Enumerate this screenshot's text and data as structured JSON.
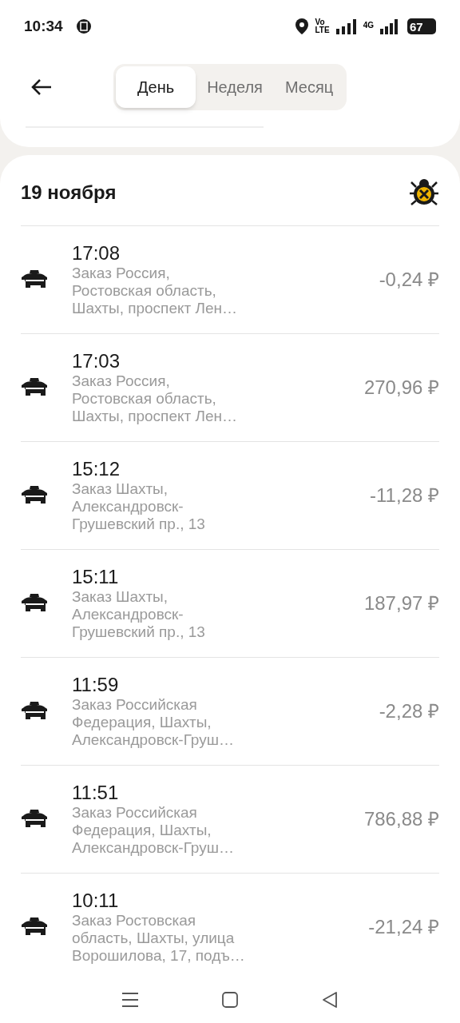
{
  "status_bar": {
    "time": "10:34",
    "volte_top": "Vo",
    "volte_bottom": "LTE",
    "network": "4G",
    "battery": "67"
  },
  "tabs": [
    {
      "label": "День",
      "selected": true
    },
    {
      "label": "Неделя",
      "selected": false
    },
    {
      "label": "Месяц",
      "selected": false
    }
  ],
  "date_heading": "19 ноября",
  "orders": [
    {
      "time": "17:08",
      "description": [
        "Заказ Россия,",
        "Ростовская область,",
        "Шахты, проспект Лен…"
      ],
      "amount": "-0,24 ₽"
    },
    {
      "time": "17:03",
      "description": [
        "Заказ Россия,",
        "Ростовская область,",
        "Шахты, проспект Лен…"
      ],
      "amount": "270,96 ₽"
    },
    {
      "time": "15:12",
      "description": [
        "Заказ Шахты,",
        "Александровск-",
        "Грушевский пр., 13"
      ],
      "amount": "-11,28 ₽"
    },
    {
      "time": "15:11",
      "description": [
        "Заказ Шахты,",
        "Александровск-",
        "Грушевский пр., 13"
      ],
      "amount": "187,97 ₽"
    },
    {
      "time": "11:59",
      "description": [
        "Заказ Российская",
        "Федерация, Шахты,",
        "Александровск-Груш…"
      ],
      "amount": "-2,28 ₽"
    },
    {
      "time": "11:51",
      "description": [
        "Заказ Российская",
        "Федерация, Шахты,",
        "Александровск-Груш…"
      ],
      "amount": "786,88 ₽"
    },
    {
      "time": "10:11",
      "description": [
        "Заказ Ростовская",
        "область, Шахты, улица",
        "Ворошилова, 17, подъ…"
      ],
      "amount": "-21,24 ₽"
    }
  ]
}
